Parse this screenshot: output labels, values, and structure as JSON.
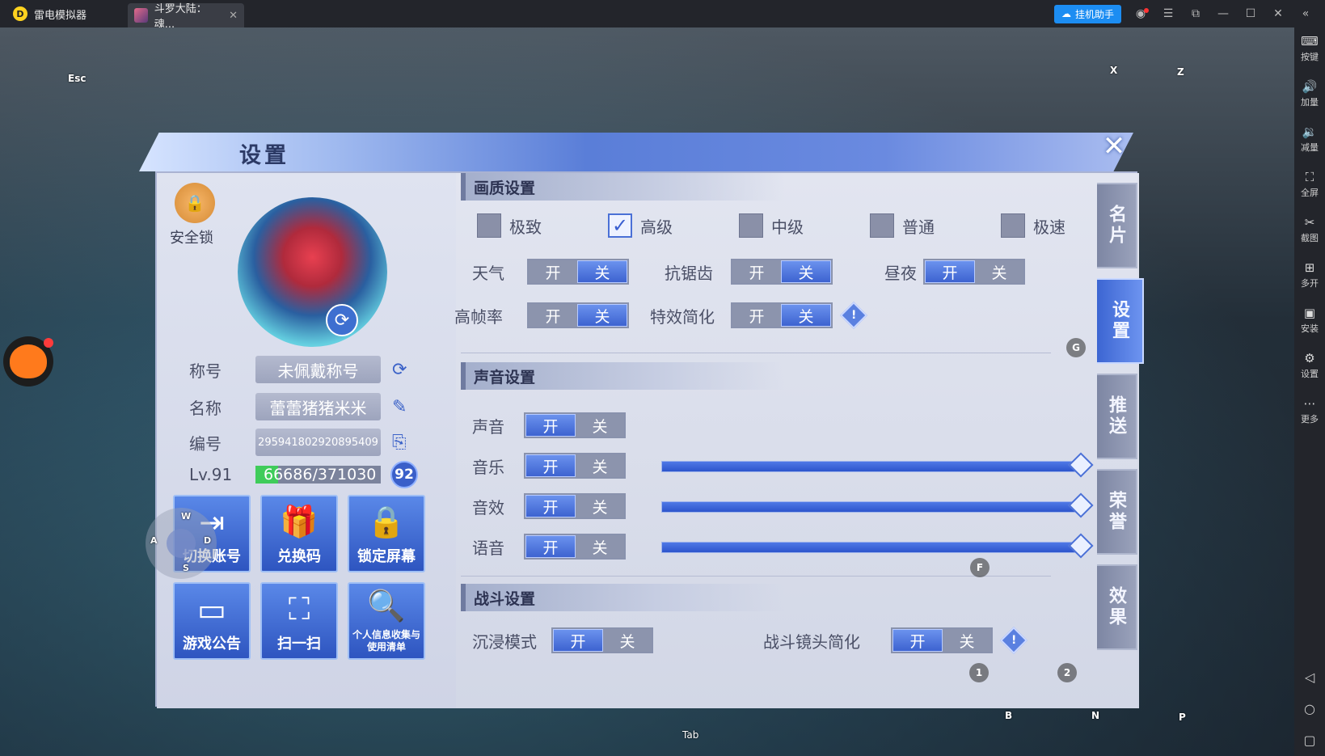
{
  "titlebar": {
    "app_name": "雷电模拟器",
    "tab_label": "斗罗大陆：魂...",
    "helper_button": "挂机助手"
  },
  "sidebar": {
    "items": [
      {
        "icon": "keyboard-icon",
        "label": "按键"
      },
      {
        "icon": "volume-up-icon",
        "label": "加量"
      },
      {
        "icon": "volume-down-icon",
        "label": "减量"
      },
      {
        "icon": "fullscreen-icon",
        "label": "全屏"
      },
      {
        "icon": "scissors-icon",
        "label": "截图"
      },
      {
        "icon": "multi-instance-icon",
        "label": "多开"
      },
      {
        "icon": "apk-icon",
        "label": "安装"
      },
      {
        "icon": "gear-icon",
        "label": "设置"
      },
      {
        "icon": "more-icon",
        "label": "更多"
      }
    ]
  },
  "keys": {
    "esc": "Esc",
    "x": "X",
    "z": "Z",
    "g": "G",
    "f": "F",
    "one": "1",
    "two": "2",
    "b": "B",
    "n": "N",
    "p": "P",
    "tab": "Tab",
    "w": "W",
    "a": "A",
    "s": "S",
    "d": "D"
  },
  "panel": {
    "title": "设置",
    "side_tabs": [
      "名片",
      "设置",
      "推送",
      "荣誉",
      "效果"
    ],
    "active_tab": "设置"
  },
  "profile": {
    "lock_label": "安全锁",
    "title_label": "称号",
    "title_value": "未佩戴称号",
    "name_label": "名称",
    "name_value": "蕾蕾猪猪米米",
    "id_label": "编号",
    "id_value": "295941802920895409",
    "level_label": "Lv.91",
    "exp_value": "66686/371030",
    "exp_fraction": 0.18,
    "next_level": "92",
    "buttons": [
      "切换账号",
      "兑换码",
      "锁定屏幕",
      "游戏公告",
      "扫一扫",
      "个人信息收集与使用清单"
    ]
  },
  "quality": {
    "section_title": "画质设置",
    "options": [
      "极致",
      "高级",
      "中级",
      "普通",
      "极速"
    ],
    "selected": "高级",
    "on_label": "开",
    "off_label": "关",
    "weather_label": "天气",
    "antialias_label": "抗锯齿",
    "daynight_label": "昼夜",
    "highfps_label": "高帧率",
    "effects_label": "特效简化"
  },
  "sound": {
    "section_title": "声音设置",
    "sound_label": "声音",
    "music_label": "音乐",
    "sfx_label": "音效",
    "voice_label": "语音",
    "music_level": 1.0,
    "sfx_level": 1.0,
    "voice_level": 1.0
  },
  "battle": {
    "section_title": "战斗设置",
    "immersive_label": "沉浸模式",
    "camera_label": "战斗镜头简化"
  }
}
